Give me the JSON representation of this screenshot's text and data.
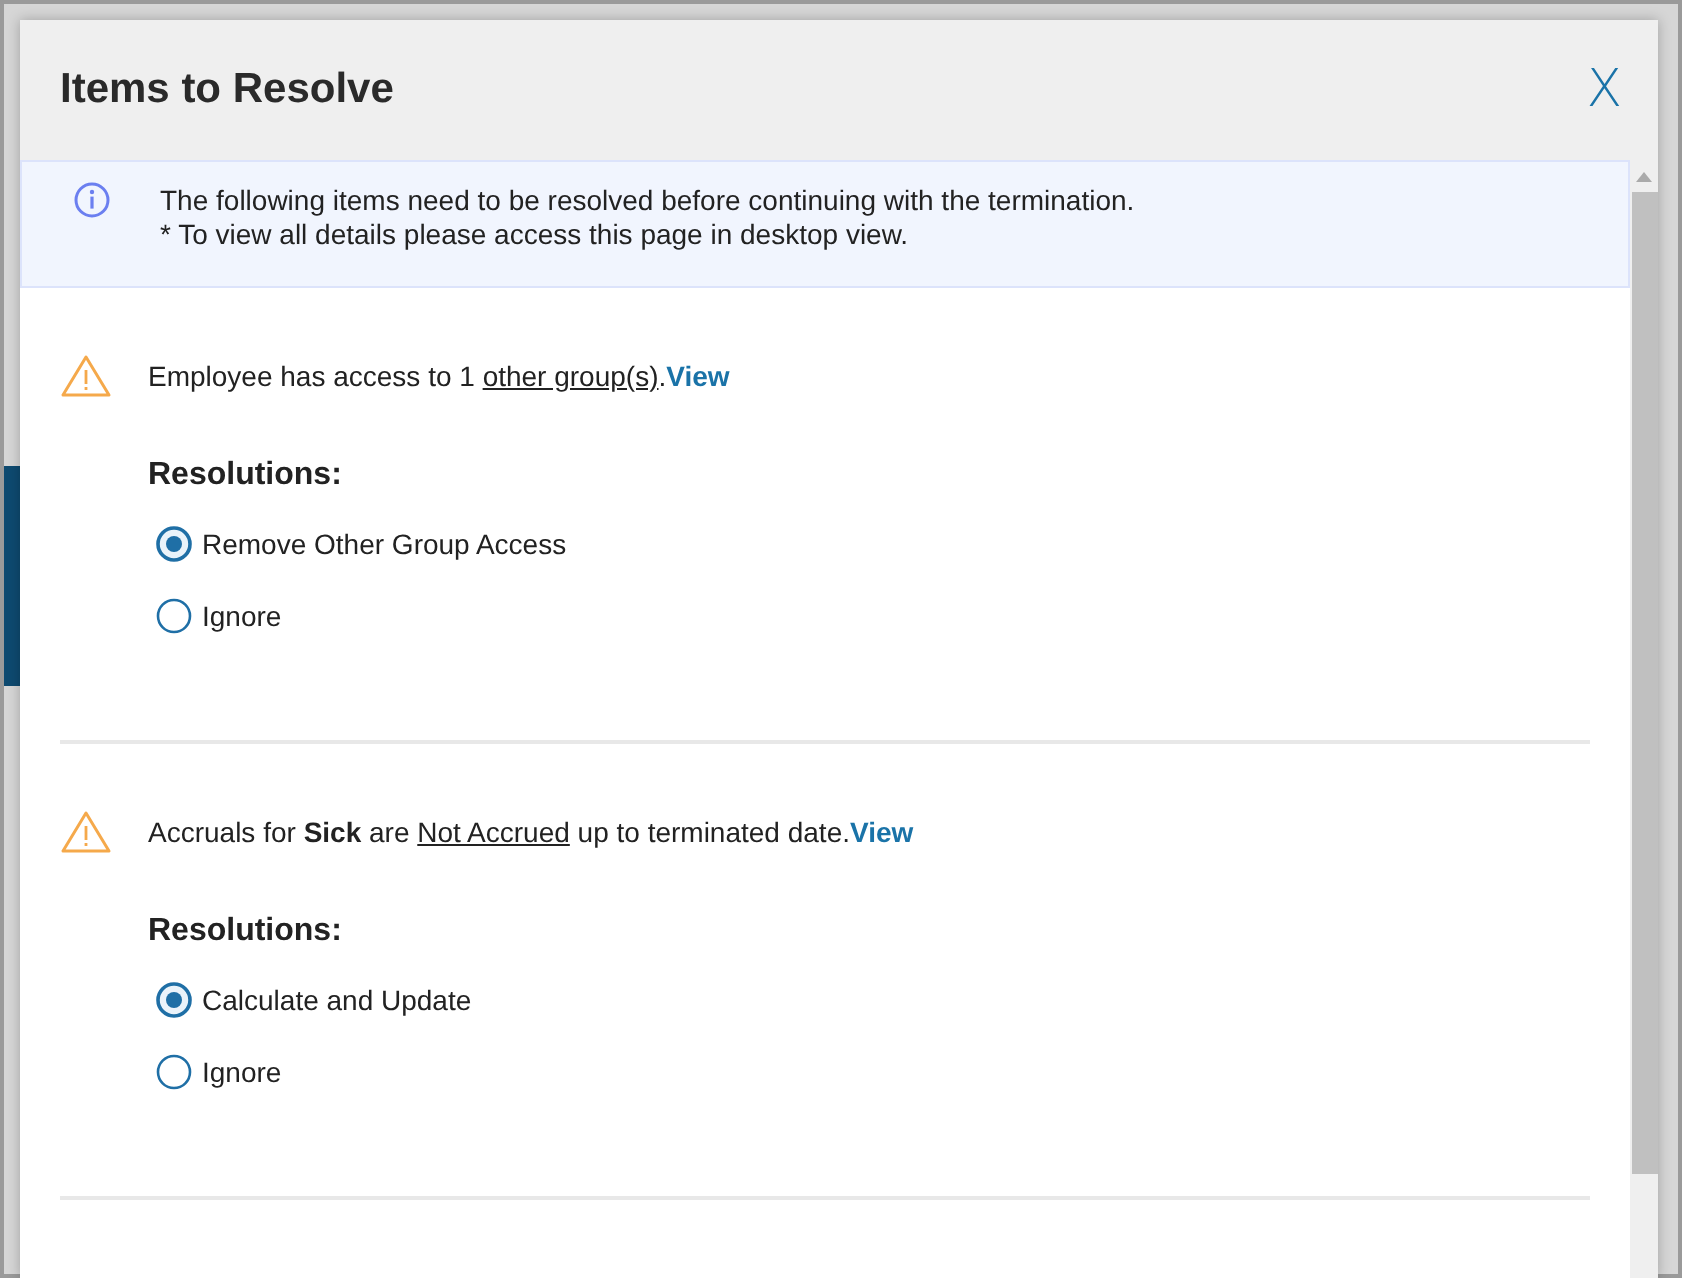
{
  "dialog": {
    "title": "Items to Resolve",
    "close_label": "X"
  },
  "notice": {
    "lines": [
      "The following items need to be resolved before continuing with the termination.",
      "* To view all details please access this page in desktop view."
    ]
  },
  "items": [
    {
      "message": [
        {
          "text": "Employee has access to 1 ",
          "kind": "plain"
        },
        {
          "text": "other group(s)",
          "kind": "underline"
        },
        {
          "text": ".",
          "kind": "plain"
        }
      ],
      "link": "View",
      "resolutions_label": "Resolutions:",
      "options": [
        {
          "label": "Remove Other Group Access",
          "selected": true
        },
        {
          "label": "Ignore",
          "selected": false
        }
      ]
    },
    {
      "message": [
        {
          "text": "Accruals for ",
          "kind": "plain"
        },
        {
          "text": "Sick",
          "kind": "bold"
        },
        {
          "text": " are ",
          "kind": "plain"
        },
        {
          "text": "Not Accrued",
          "kind": "underline"
        },
        {
          "text": " up to terminated date.",
          "kind": "plain"
        }
      ],
      "link": "View",
      "resolutions_label": "Resolutions:",
      "options": [
        {
          "label": "Calculate and Update",
          "selected": true
        },
        {
          "label": "Ignore",
          "selected": false
        }
      ]
    }
  ]
}
